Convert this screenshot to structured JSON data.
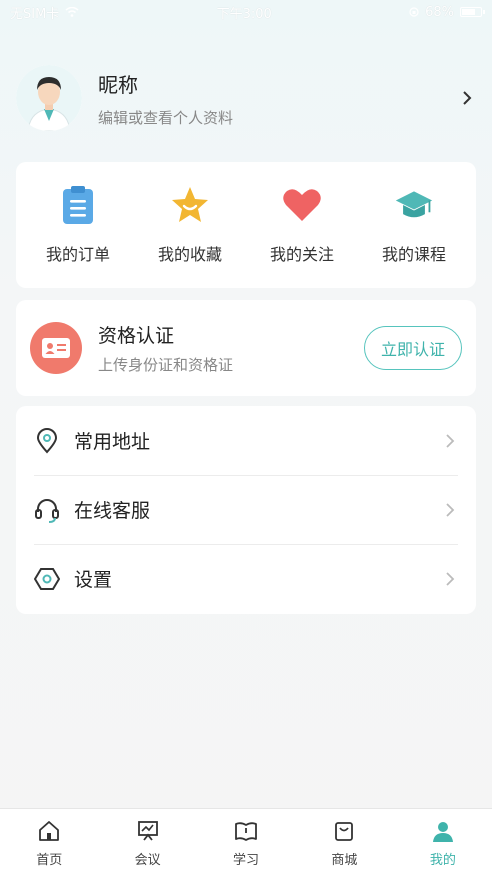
{
  "status_bar": {
    "carrier": "无SIM卡",
    "time": "下午3:00",
    "battery": "68%"
  },
  "profile": {
    "nickname": "昵称",
    "subtitle": "编辑或查看个人资料"
  },
  "orders": {
    "items": [
      {
        "label": "我的订单",
        "icon": "clipboard-icon"
      },
      {
        "label": "我的收藏",
        "icon": "star-icon"
      },
      {
        "label": "我的关注",
        "icon": "heart-icon"
      },
      {
        "label": "我的课程",
        "icon": "graduation-cap-icon"
      }
    ]
  },
  "certification": {
    "title": "资格认证",
    "subtitle": "上传身份证和资格证",
    "button": "立即认证"
  },
  "menu": {
    "items": [
      {
        "label": "常用地址",
        "icon": "location-pin-icon"
      },
      {
        "label": "在线客服",
        "icon": "headset-icon"
      },
      {
        "label": "设置",
        "icon": "settings-hexagon-icon"
      }
    ]
  },
  "tabs": [
    {
      "label": "首页",
      "icon": "home-icon",
      "active": false
    },
    {
      "label": "会议",
      "icon": "presentation-icon",
      "active": false
    },
    {
      "label": "学习",
      "icon": "book-icon",
      "active": false
    },
    {
      "label": "商城",
      "icon": "shopping-bag-icon",
      "active": false
    },
    {
      "label": "我的",
      "icon": "user-icon",
      "active": true
    }
  ],
  "colors": {
    "accent": "#3fb3ab",
    "cert_badge": "#f07a6c",
    "clipboard": "#5aa9e6",
    "star": "#f2b632",
    "heart": "#ef6363",
    "cap": "#4fb8b6"
  }
}
